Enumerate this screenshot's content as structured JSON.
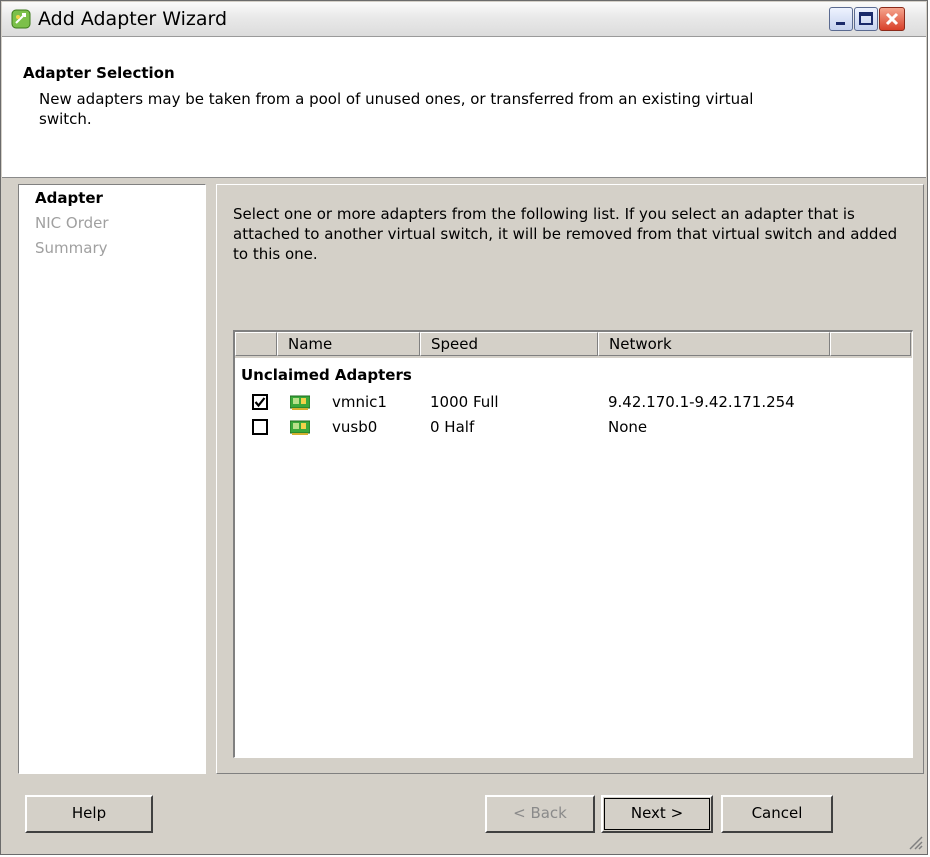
{
  "window": {
    "title": "Add Adapter Wizard",
    "icon": "wizard-app-icon"
  },
  "header": {
    "title": "Adapter Selection",
    "description": "New adapters may be taken from a pool of unused ones, or transferred from an existing virtual switch."
  },
  "steps": [
    {
      "label": "Adapter",
      "state": "active"
    },
    {
      "label": "NIC Order",
      "state": "inactive"
    },
    {
      "label": "Summary",
      "state": "inactive"
    }
  ],
  "content": {
    "instructions": "Select one or more adapters from the following list. If you select an adapter that is attached to another virtual switch, it will be removed from that virtual switch and added to this one."
  },
  "table": {
    "columns": [
      "Name",
      "Speed",
      "Network"
    ],
    "group_label": "Unclaimed Adapters",
    "rows": [
      {
        "checked": true,
        "icon": "network-card-icon",
        "name": "vmnic1",
        "speed": "1000 Full",
        "network": "9.42.170.1-9.42.171.254"
      },
      {
        "checked": false,
        "icon": "network-card-icon",
        "name": "vusb0",
        "speed": "0 Half",
        "network": "None"
      }
    ]
  },
  "buttons": {
    "help": "Help",
    "back": "< Back",
    "next": "Next >",
    "cancel": "Cancel"
  },
  "colors": {
    "dialog_bg": "#d4d0c8",
    "close_button": "#d8402a",
    "nic_icon": "#3aa83a"
  }
}
